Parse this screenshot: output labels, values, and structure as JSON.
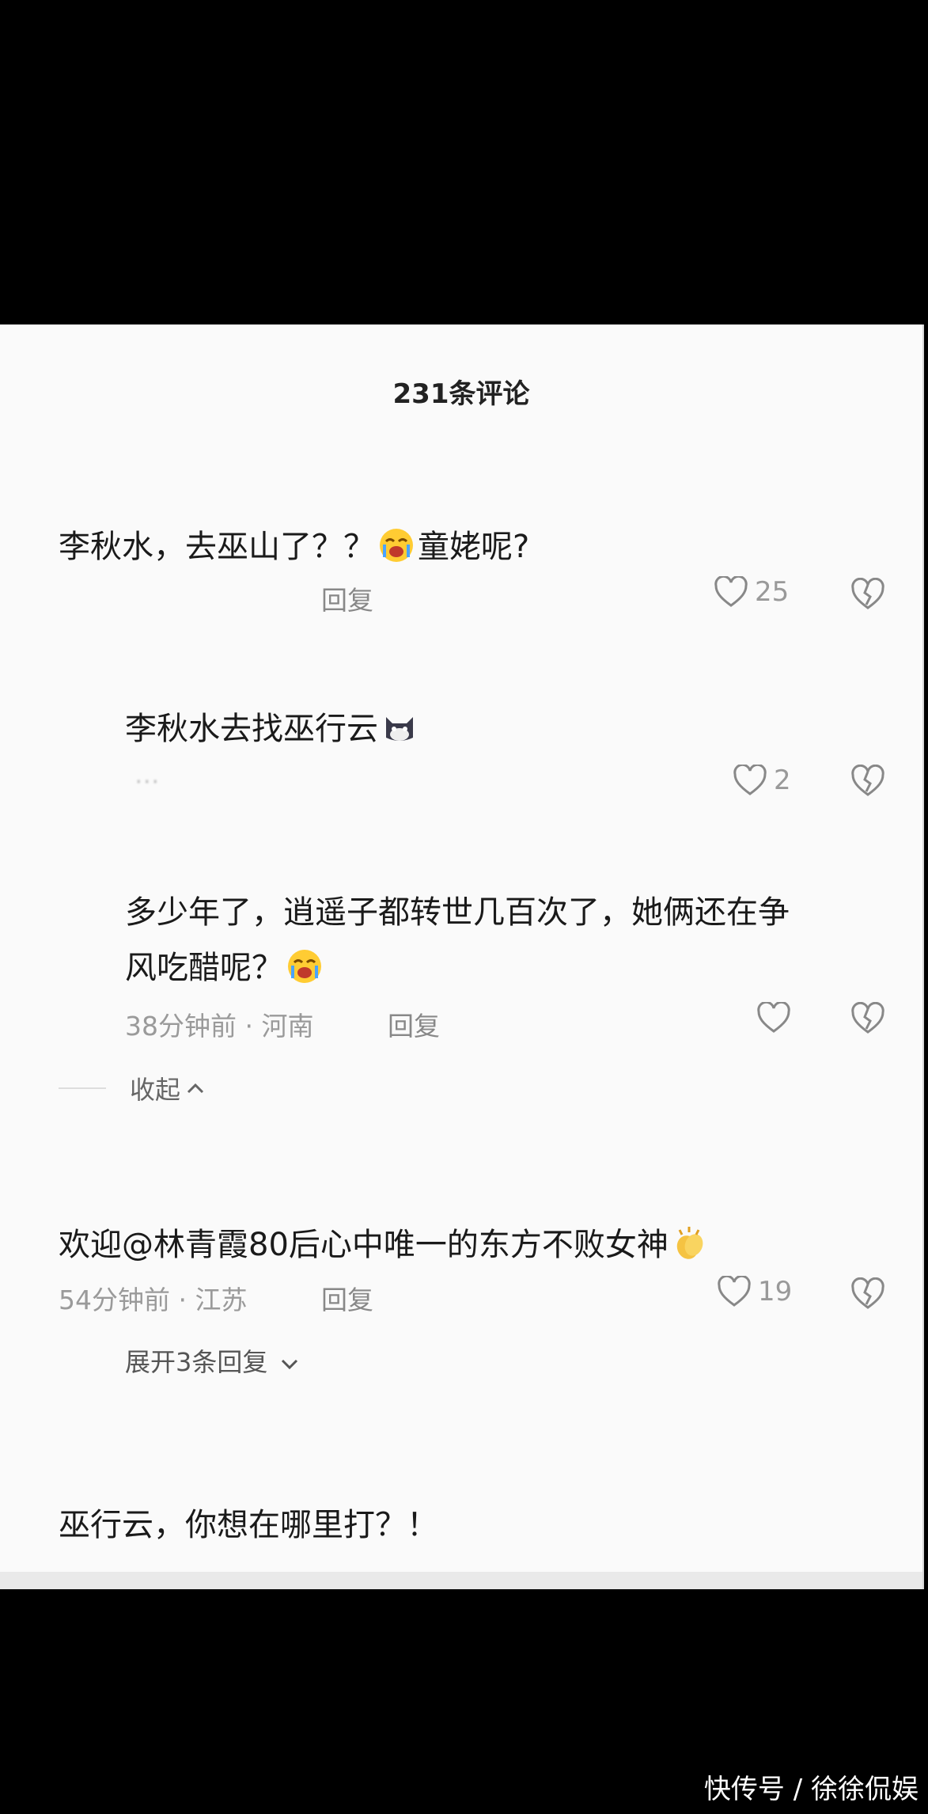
{
  "header": {
    "title": "231条评论"
  },
  "comments": [
    {
      "text_a": "李秋水，去巫山了？？",
      "emoji": "loudly-crying-emoji",
      "text_b": "童姥呢?",
      "reply_label": "回复",
      "likes": "25"
    },
    {
      "text": "李秋水去找巫行云",
      "emoji": "cat-emoji",
      "meta": "···",
      "likes": "2"
    },
    {
      "line1": "多少年了，逍遥子都转世几百次了，她俩还在争",
      "line2": "风吃醋呢？",
      "emoji": "loudly-crying-emoji",
      "meta": "38分钟前 · 河南",
      "reply_label": "回复",
      "likes": ""
    },
    {
      "text": "欢迎@林青霞80后心中唯一的东方不败女神",
      "emoji": "clapping-hands-emoji",
      "meta": "54分钟前 · 江苏",
      "reply_label": "回复",
      "likes": "19"
    },
    {
      "text": "巫行云，你想在哪里打？！"
    }
  ],
  "collapse_label": "收起",
  "expand_label": "展开3条回复",
  "watermark": "快传号 / 徐徐侃娱",
  "colors": {
    "background": "#000000",
    "panel": "#fafafa",
    "meta_text": "#9a9a9a"
  }
}
